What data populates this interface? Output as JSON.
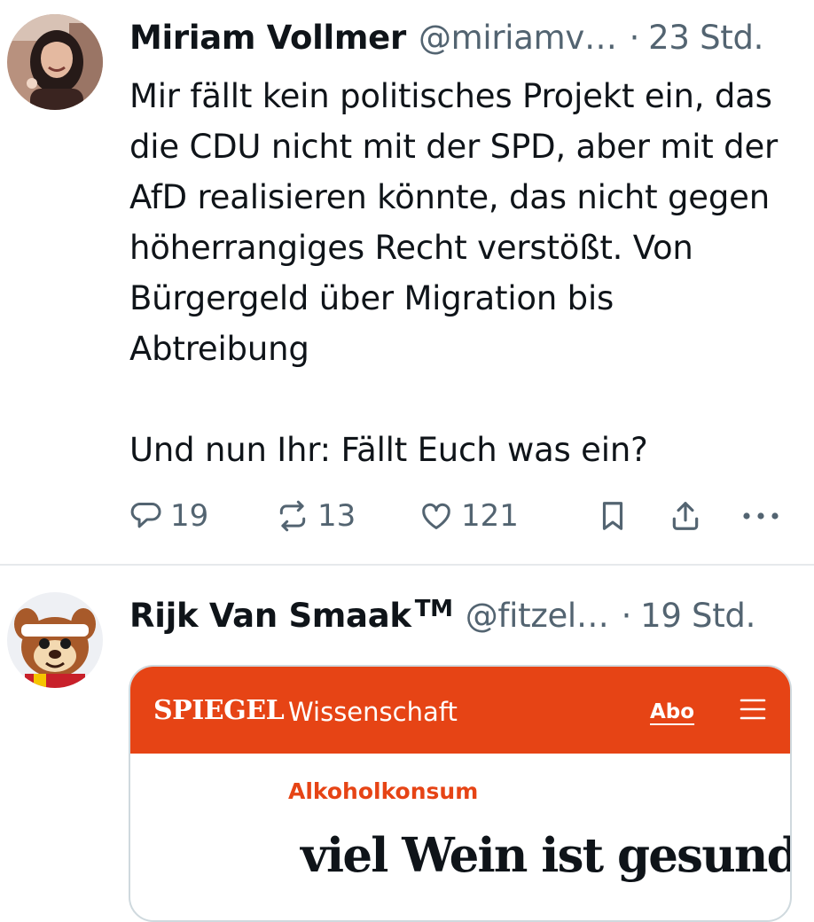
{
  "tweets": [
    {
      "name": "Miriam Vollmer",
      "handle": "@miriamv…",
      "separator": "·",
      "time": "23 Std.",
      "text_paragraphs": [
        "Mir fällt kein politisches Projekt ein, das die CDU nicht mit der SPD, aber mit der AfD realisieren könnte, das nicht gegen höherrangiges Recht verstößt. Von Bürgergeld über Migration bis Abtreibung",
        "Und nun Ihr: Fällt Euch was ein?"
      ],
      "actions": {
        "replies": "19",
        "retweets": "13",
        "likes": "121"
      }
    },
    {
      "name": "Rijk Van Smaak",
      "name_suffix": "TM",
      "handle": "@fitzel…",
      "separator": "·",
      "time": "19 Std.",
      "card": {
        "brand": "SPIEGEL",
        "section": "Wissenschaft",
        "abo_label": "Abo",
        "kicker": "Alkoholkonsum",
        "headline": "viel Wein ist gesund"
      }
    }
  ],
  "icons": {
    "reply": "speech-bubble",
    "retweet": "two-arrows-loop",
    "like": "heart-outline",
    "bookmark": "bookmark-outline",
    "share": "upload-arrow",
    "more": "three-dots",
    "card_menu": "hamburger"
  },
  "colors": {
    "text": "#0f1419",
    "secondary": "#536471",
    "spiegel_orange": "#e64415",
    "divider": "#e6e9ec"
  }
}
